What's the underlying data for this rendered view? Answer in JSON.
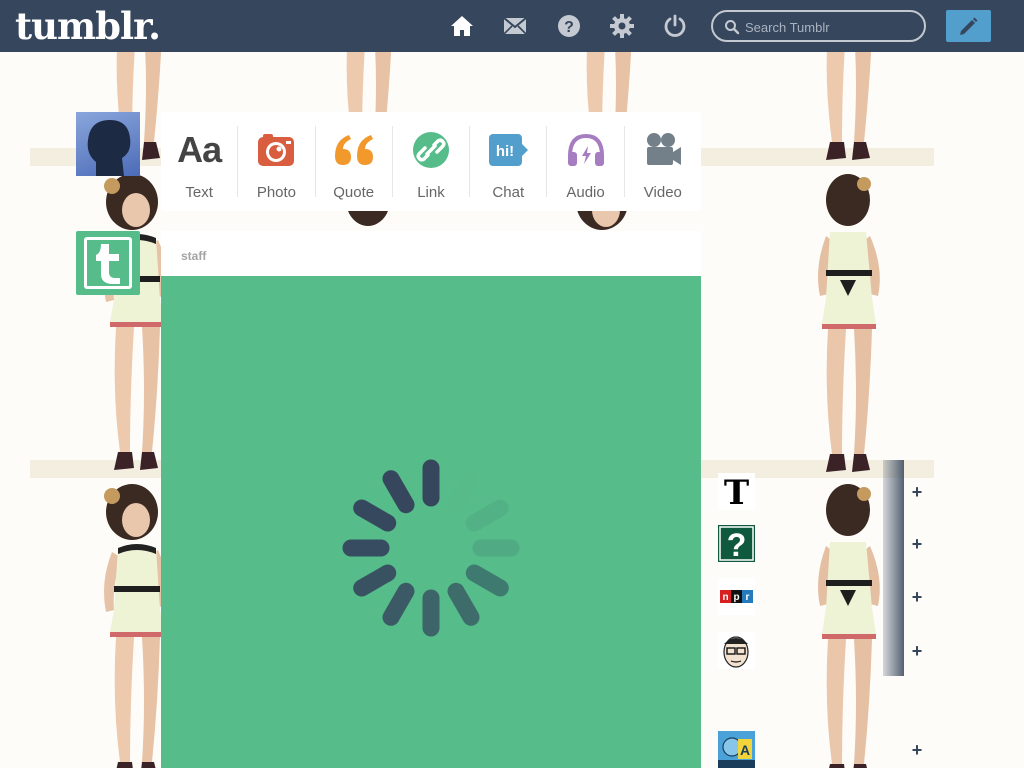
{
  "header": {
    "logo": "tumblr.",
    "nav_icons": [
      "home-icon",
      "mail-icon",
      "help-icon",
      "settings-icon",
      "power-icon"
    ],
    "search_placeholder": "Search Tumblr",
    "compose_icon": "pencil-icon",
    "colors": {
      "bar": "#36465d",
      "compose": "#529ecc"
    }
  },
  "post_types": [
    {
      "label": "Text",
      "icon": "text-icon",
      "color": "#444444"
    },
    {
      "label": "Photo",
      "icon": "camera-icon",
      "color": "#d95e40"
    },
    {
      "label": "Quote",
      "icon": "quote-icon",
      "color": "#f2992e"
    },
    {
      "label": "Link",
      "icon": "link-icon",
      "color": "#56bc8a"
    },
    {
      "label": "Chat",
      "icon": "chat-icon",
      "color": "#529ecc"
    },
    {
      "label": "Audio",
      "icon": "headphones-icon",
      "color": "#a77dc2"
    },
    {
      "label": "Video",
      "icon": "video-camera-icon",
      "color": "#748089"
    }
  ],
  "post": {
    "author": "staff",
    "media_color": "#56bc8a",
    "state": "loading"
  },
  "sidebar": {
    "recommended": [
      {
        "avatar": "blog-avatar-t",
        "name": "",
        "sub": ""
      },
      {
        "avatar": "blog-avatar-question",
        "name": "",
        "sub": ""
      },
      {
        "avatar": "blog-avatar-npr",
        "name": "",
        "sub": ""
      },
      {
        "avatar": "blog-avatar-face",
        "name": "",
        "sub": ""
      },
      {
        "avatar": "blog-avatar-cartoon",
        "name": "",
        "sub": ""
      }
    ]
  }
}
